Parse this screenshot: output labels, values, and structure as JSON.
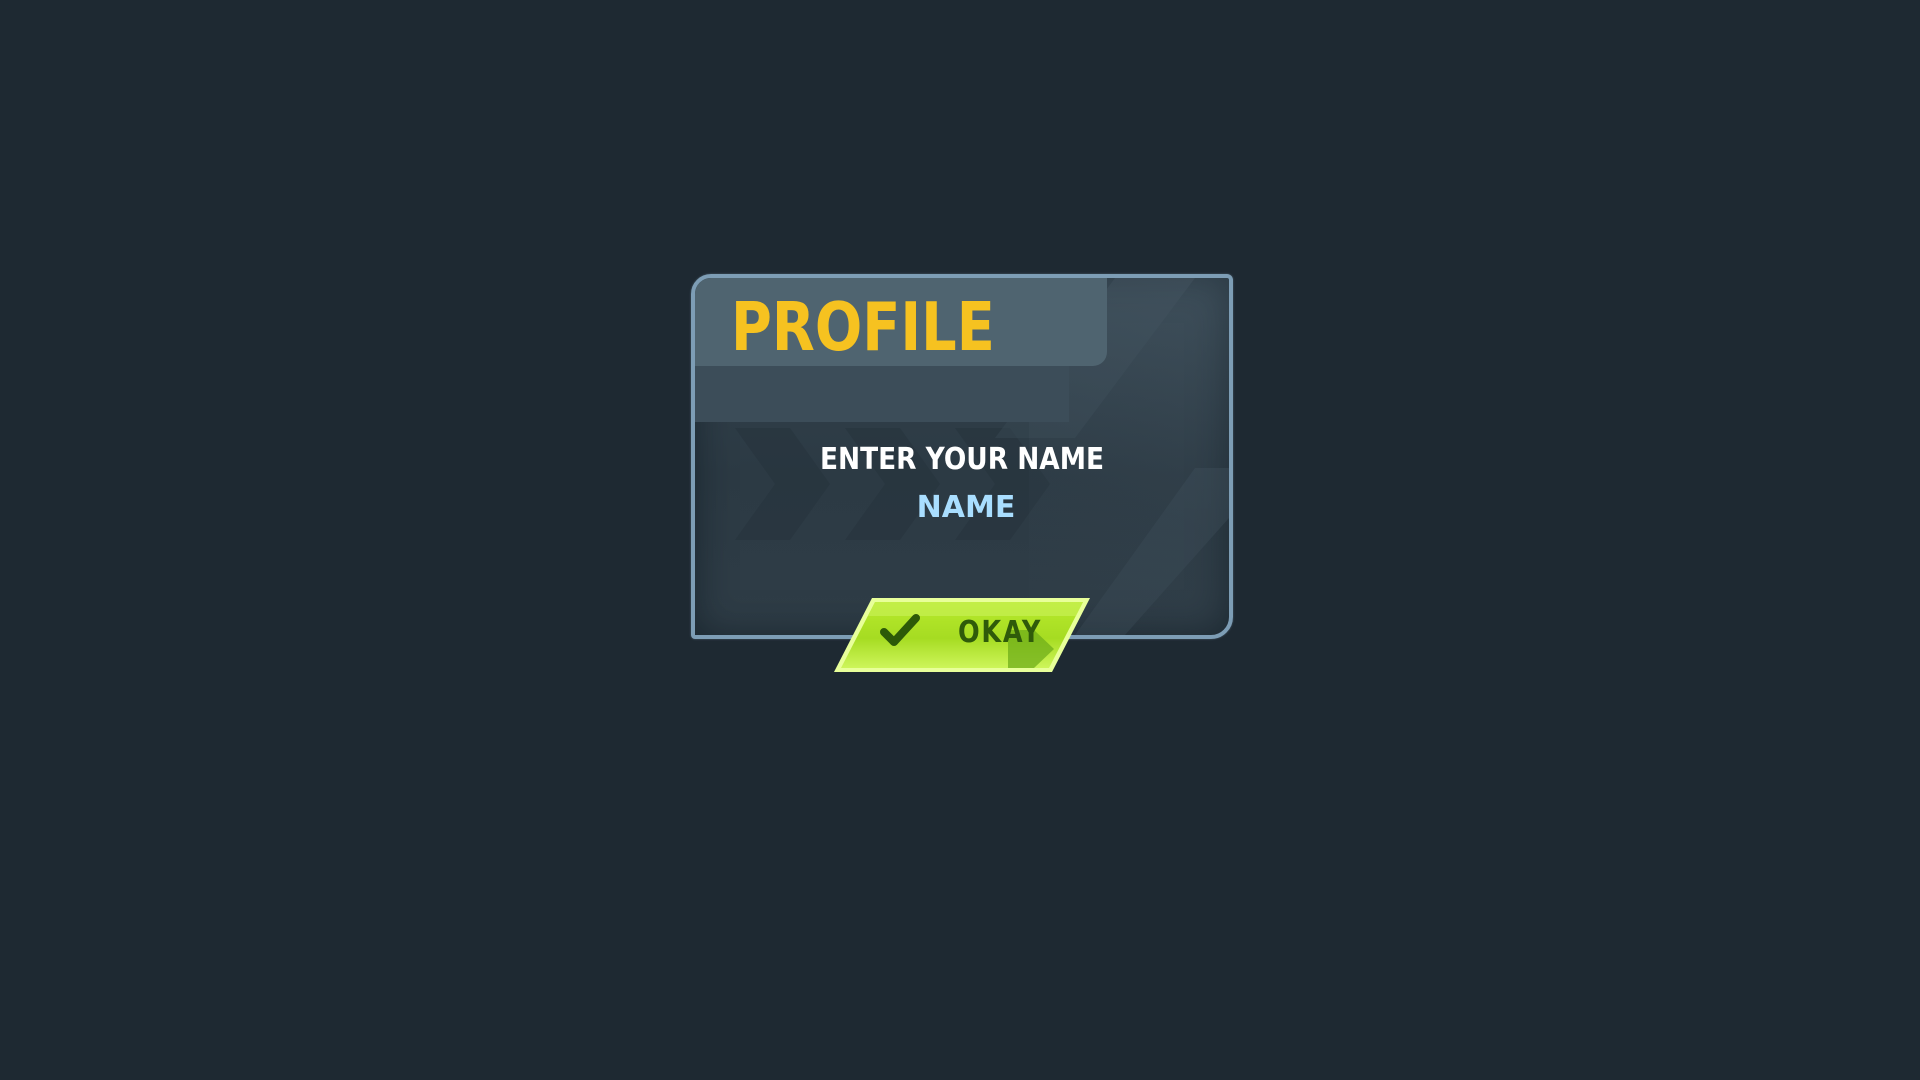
{
  "panel": {
    "title": "PROFILE",
    "prompt": "ENTER YOUR NAME"
  },
  "name_field": {
    "placeholder": "NAME",
    "value": ""
  },
  "okay_button": {
    "label": "OKAY",
    "icon": "checkmark-icon",
    "arrow_icon": "arrow-right-icon"
  },
  "colors": {
    "background": "#1e2932",
    "panel_border": "#7d9db5",
    "title": "#f6c220",
    "prompt": "#ffffff",
    "placeholder": "#a9deff",
    "button_fill": "#c6f03a",
    "button_text": "#2f5b0a"
  }
}
